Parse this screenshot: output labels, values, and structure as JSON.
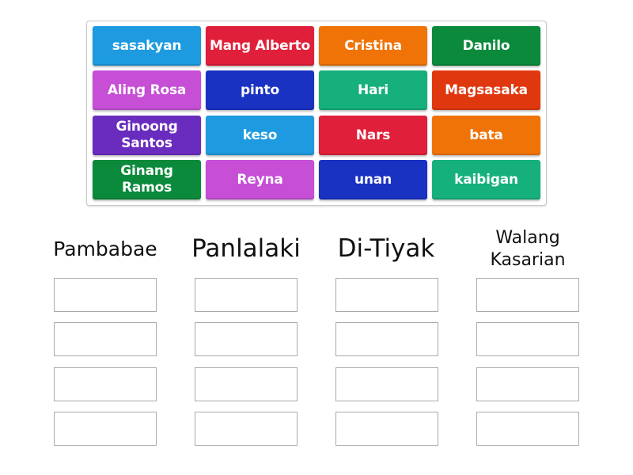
{
  "tiles": [
    {
      "label": "sasakyan",
      "color": "#1e9be0"
    },
    {
      "label": "Mang Alberto",
      "color": "#e0203a"
    },
    {
      "label": "Cristina",
      "color": "#f07308"
    },
    {
      "label": "Danilo",
      "color": "#0b8a3c"
    },
    {
      "label": "Aling Rosa",
      "color": "#c64fd6"
    },
    {
      "label": "pinto",
      "color": "#1a32c2"
    },
    {
      "label": "Hari",
      "color": "#16b07c"
    },
    {
      "label": "Magsasaka",
      "color": "#e0380e"
    },
    {
      "label": "Ginoong Santos",
      "color": "#6a2cbf"
    },
    {
      "label": "keso",
      "color": "#1e9be0"
    },
    {
      "label": "Nars",
      "color": "#e0203a"
    },
    {
      "label": "bata",
      "color": "#f07308"
    },
    {
      "label": "Ginang Ramos",
      "color": "#0b8a3c"
    },
    {
      "label": "Reyna",
      "color": "#c64fd6"
    },
    {
      "label": "unan",
      "color": "#1a32c2"
    },
    {
      "label": "kaibigan",
      "color": "#16b07c"
    }
  ],
  "categories": [
    {
      "title": "Pambabae",
      "slots": 4
    },
    {
      "title": "Panlalaki",
      "slots": 4
    },
    {
      "title": "Di-Tiyak",
      "slots": 4
    },
    {
      "title": "Walang Kasarian",
      "slots": 4
    }
  ]
}
